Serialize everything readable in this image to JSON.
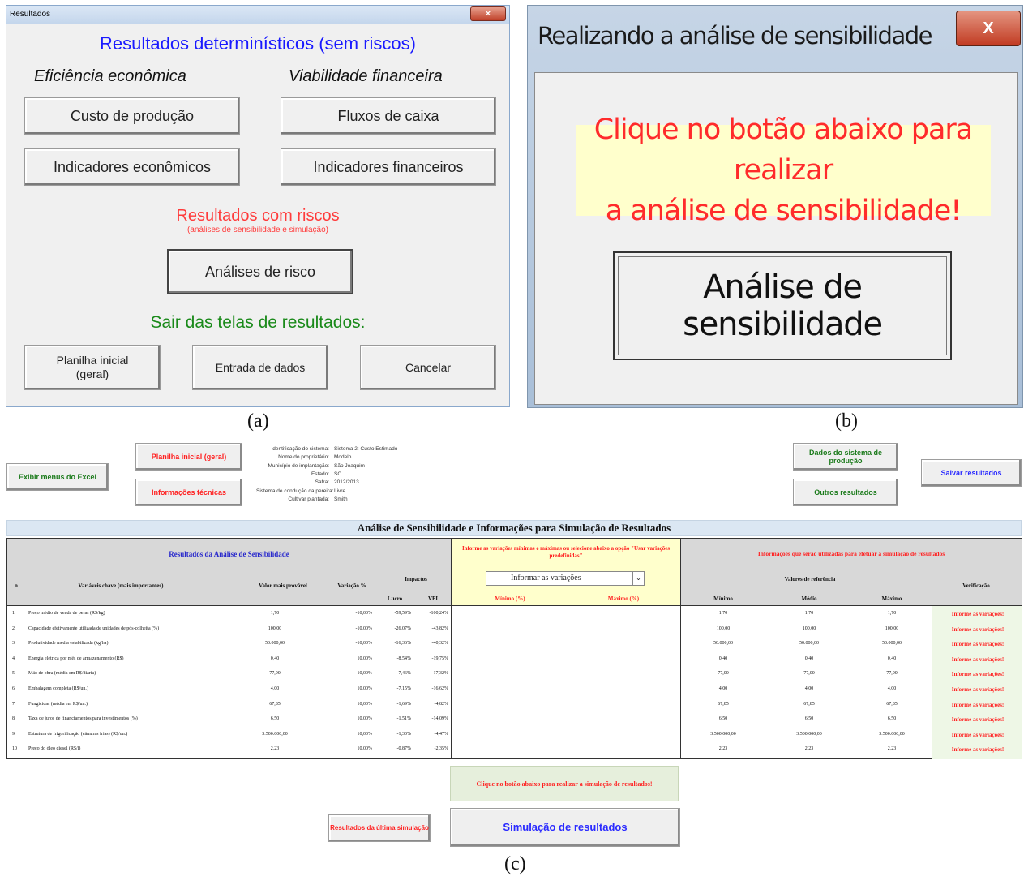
{
  "panel_a": {
    "window_title": "Resultados",
    "close_glyph": "×",
    "heading_deterministic": "Resultados determinísticos (sem riscos)",
    "col1_title": "Eficiência econômica",
    "col2_title": "Viabilidade financeira",
    "btn_custo": "Custo de produção",
    "btn_fluxos": "Fluxos de caixa",
    "btn_ind_econ": "Indicadores econômicos",
    "btn_ind_fin": "Indicadores financeiros",
    "heading_risks": "Resultados com riscos",
    "subheading_risks": "(análises de sensibilidade e simulação)",
    "btn_risco": "Análises de risco",
    "heading_exit": "Sair das telas de resultados:",
    "btn_planilha_line1": "Planilha inicial",
    "btn_planilha_line2": "(geral)",
    "btn_entrada": "Entrada de dados",
    "btn_cancelar": "Cancelar",
    "caption": "(a)",
    "colors": {
      "blue": "#1a1aff",
      "red": "#ff3b3b",
      "green": "#1a8a1a"
    }
  },
  "panel_b": {
    "window_title": "Realizando a análise de sensibilidade",
    "close_glyph": "X",
    "note_line1": "Clique no botão abaixo para realizar",
    "note_line2": "a análise de sensibilidade!",
    "btn_sens": "Análise de sensibilidade",
    "caption": "(b)"
  },
  "panel_c": {
    "btn_exibir": "Exibir menus do Excel",
    "btn_planilha": "Planilha inicial (geral)",
    "btn_info": "Informações técnicas",
    "id_rows": [
      {
        "label": "Identificação do sistema:",
        "value": "Sistema 2: Custo Estimado"
      },
      {
        "label": "Nome do proprietário:",
        "value": "Modelo"
      },
      {
        "label": "Município de implantação:",
        "value": "São Joaquim"
      },
      {
        "label": "Estado:",
        "value": "SC"
      },
      {
        "label": "Safra:",
        "value": "2012/2013"
      },
      {
        "label": "Sistema de condução da pereira:",
        "value": "Livre"
      },
      {
        "label": "Cultivar plantada:",
        "value": "Smith"
      }
    ],
    "btn_dados": "Dados do sistema de produção",
    "btn_outros": "Outros resultados",
    "btn_salvar": "Salvar resultados",
    "title": "Análise de Sensibilidade e Informações para Simulação de Resultados",
    "left_header": "Resultados da Análise de Sensibilidade",
    "mid_header": "Informe as variações mínimas e máximas ou selecione abaixo a opção \"Usar variações predefinidas\"",
    "right_header": "Informações que serão utilizadas para efetuar a simulação de resultados",
    "col_n": "n",
    "col_var": "Variáveis chave (mais importantes)",
    "col_valor": "Valor mais provável",
    "col_variacao": "Variação %",
    "col_impactos": "Impactos",
    "col_lucro": "Lucro",
    "col_vpl": "VPL",
    "dropdown_value": "Informar as variações",
    "col_min_pct": "Mínimo (%)",
    "col_max_pct": "Máximo (%)",
    "col_valores_ref": "Valores de referência",
    "col_minimo": "Mínimo",
    "col_medio": "Médio",
    "col_maximo": "Máximo",
    "col_verif": "Verificação",
    "rows": [
      {
        "n": "1",
        "var": "Preço médio de venda de peras (R$/kg)",
        "valor": "1,70",
        "variacao": "-10,00%",
        "lucro": "-59,59%",
        "vpl": "-100,24%",
        "min": "1,70",
        "med": "1,70",
        "max": "1,70",
        "verif": "Informe as variações!"
      },
      {
        "n": "2",
        "var": "Capacidade efetivamente utilizada de unidades de pós-colheita (%)",
        "valor": "100,00",
        "variacao": "-10,00%",
        "lucro": "-26,07%",
        "vpl": "-43,82%",
        "min": "100,00",
        "med": "100,00",
        "max": "100,00",
        "verif": "Informe as variações!"
      },
      {
        "n": "3",
        "var": "Produtividade média estabilizada (kg/ha)",
        "valor": "50.000,00",
        "variacao": "-10,00%",
        "lucro": "-16,36%",
        "vpl": "-40,32%",
        "min": "50.000,00",
        "med": "50.000,00",
        "max": "50.000,00",
        "verif": "Informe as variações!"
      },
      {
        "n": "4",
        "var": "Energia elétrica por mês de armazenamento (R$)",
        "valor": "0,40",
        "variacao": "10,00%",
        "lucro": "-8,54%",
        "vpl": "-19,75%",
        "min": "0,40",
        "med": "0,40",
        "max": "0,40",
        "verif": "Informe as variações!"
      },
      {
        "n": "5",
        "var": "Mão de obra (média em R$/diária)",
        "valor": "77,00",
        "variacao": "10,00%",
        "lucro": "-7,46%",
        "vpl": "-17,32%",
        "min": "77,00",
        "med": "77,00",
        "max": "77,00",
        "verif": "Informe as variações!"
      },
      {
        "n": "6",
        "var": "Embalagem completa (R$/un.)",
        "valor": "4,00",
        "variacao": "10,00%",
        "lucro": "-7,15%",
        "vpl": "-16,62%",
        "min": "4,00",
        "med": "4,00",
        "max": "4,00",
        "verif": "Informe as variações!"
      },
      {
        "n": "7",
        "var": "Fungicidas (média em R$/un.)",
        "valor": "67,85",
        "variacao": "10,00%",
        "lucro": "-1,69%",
        "vpl": "-4,82%",
        "min": "67,85",
        "med": "67,85",
        "max": "67,85",
        "verif": "Informe as variações!"
      },
      {
        "n": "8",
        "var": "Taxa de juros de financiamentos para investimentos (%)",
        "valor": "6,50",
        "variacao": "10,00%",
        "lucro": "-1,51%",
        "vpl": "-14,09%",
        "min": "6,50",
        "med": "6,50",
        "max": "6,50",
        "verif": "Informe as variações!"
      },
      {
        "n": "9",
        "var": "Estrutura de frigorificação (câmaras frias) (R$/un.)",
        "valor": "3.500.000,00",
        "variacao": "10,00%",
        "lucro": "-1,30%",
        "vpl": "-4,47%",
        "min": "3.500.000,00",
        "med": "3.500.000,00",
        "max": "3.500.000,00",
        "verif": "Informe as variações!"
      },
      {
        "n": "10",
        "var": "Preço do óleo diesel (R$/l)",
        "valor": "2,23",
        "variacao": "10,00%",
        "lucro": "-0,87%",
        "vpl": "-2,35%",
        "min": "2,23",
        "med": "2,23",
        "max": "2,23",
        "verif": "Informe as variações!"
      }
    ],
    "sim_note": "Clique no botão abaixo para realizar a simulação de resultados!",
    "btn_ultima": "Resultados da última simulação",
    "btn_simulacao": "Simulação  de resultados",
    "caption": "(c)"
  }
}
